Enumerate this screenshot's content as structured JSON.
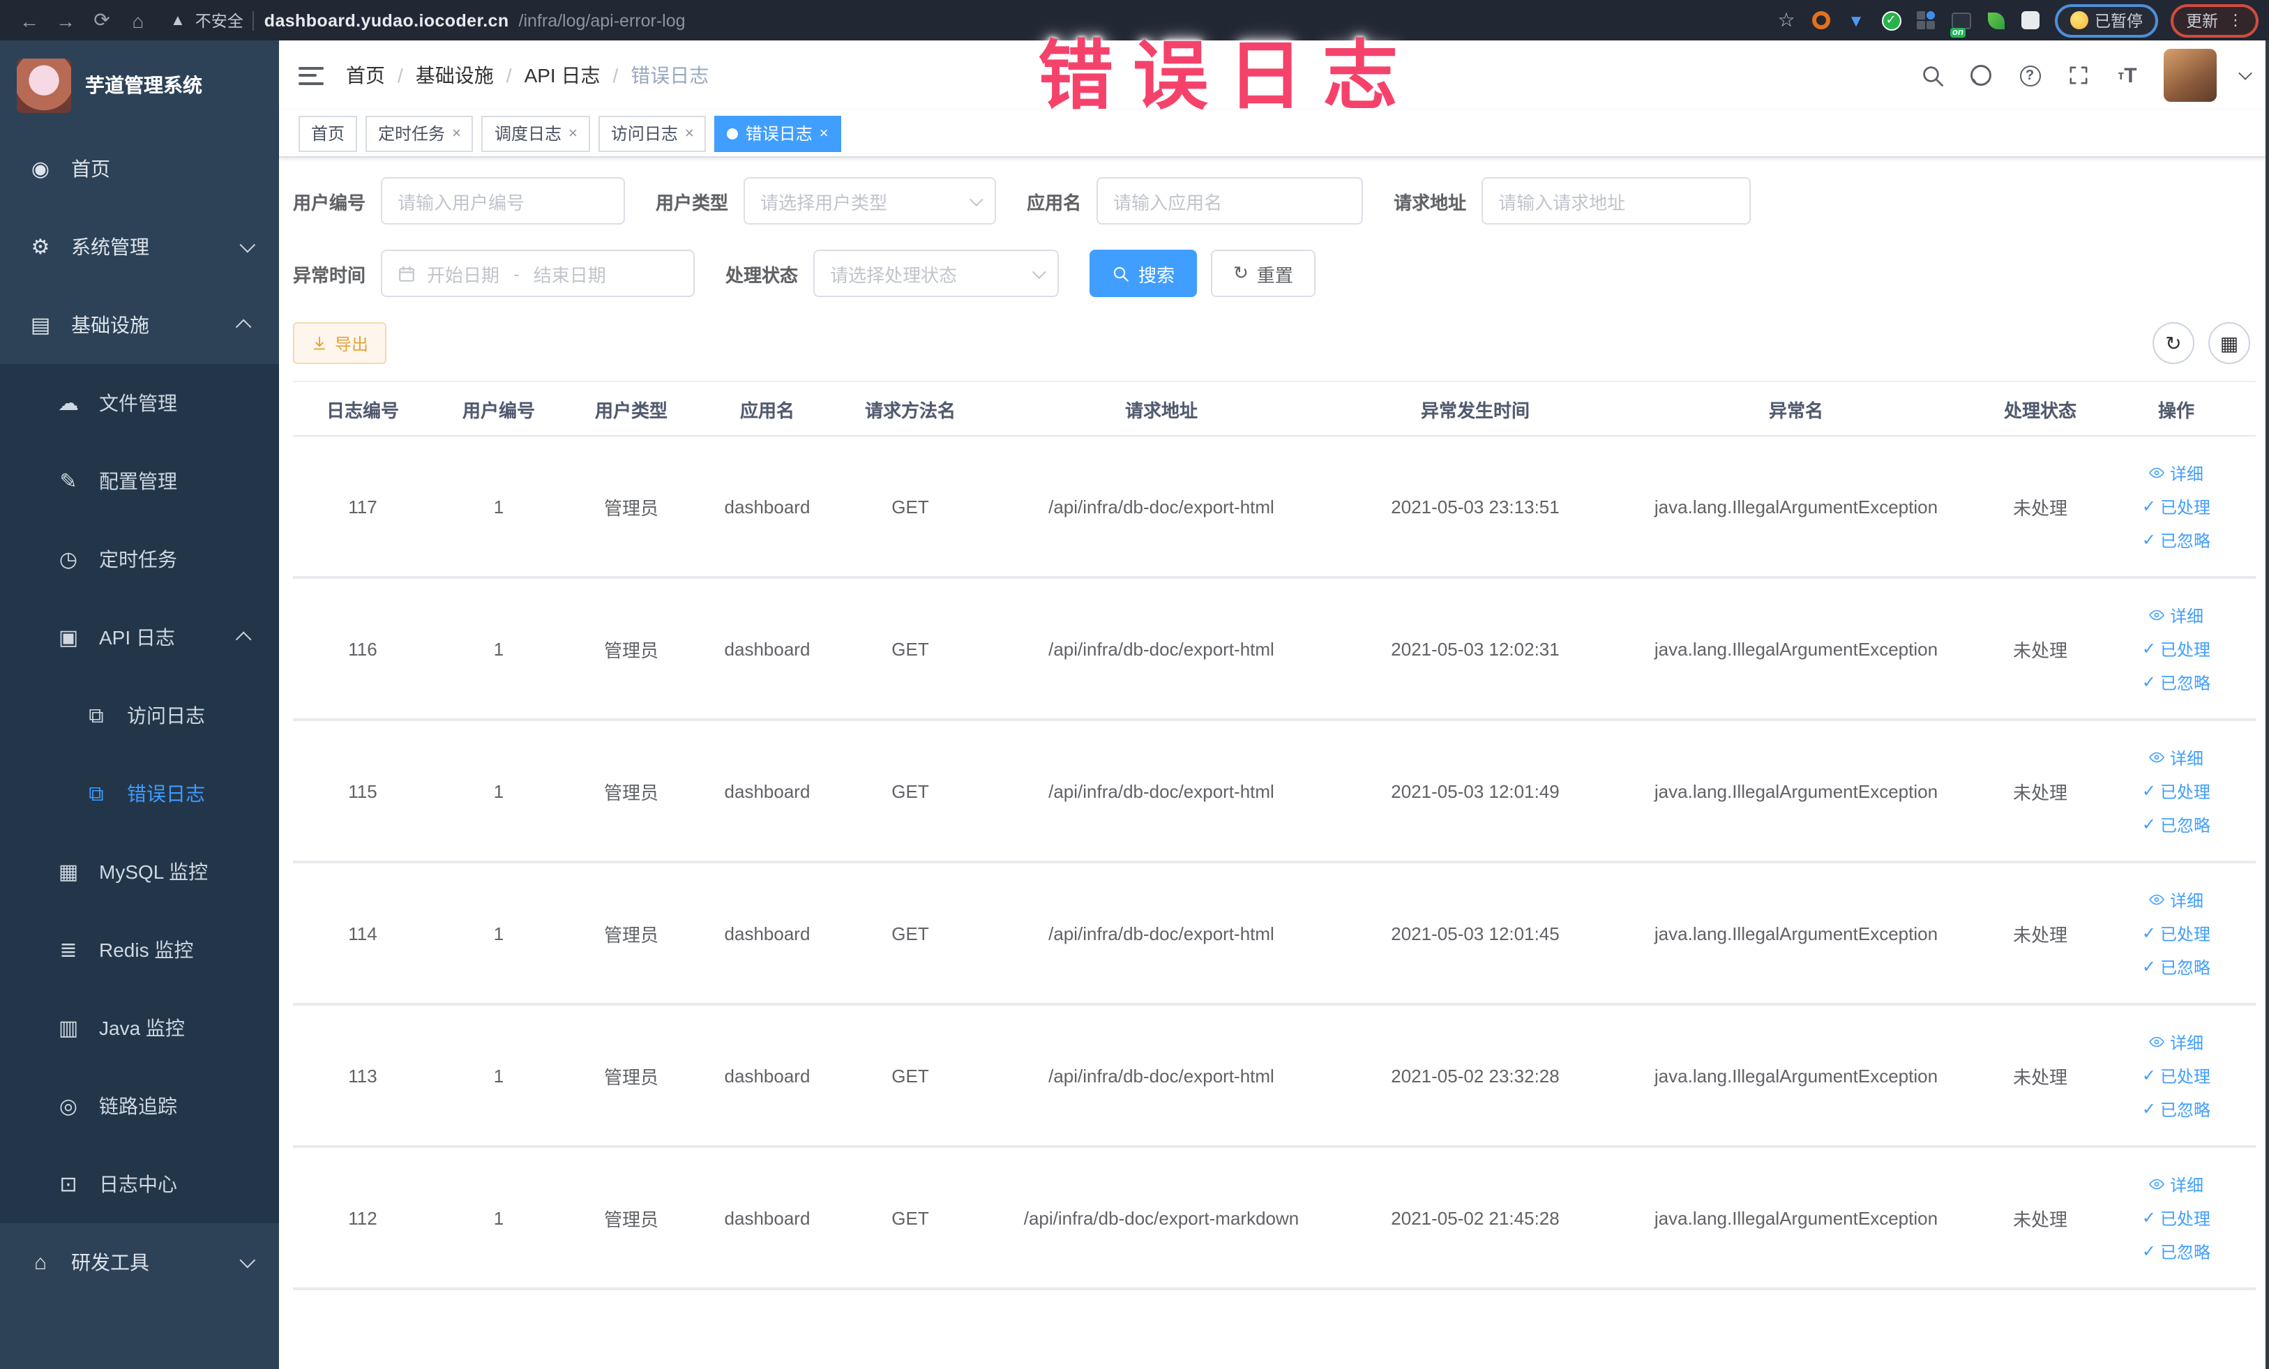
{
  "browser": {
    "nav": {
      "back": "back",
      "forward": "forward",
      "reload": "reload",
      "home": "home"
    },
    "security_label": "不安全",
    "url_host": "dashboard.yudao.iocoder.cn",
    "url_path": "/infra/log/api-error-log",
    "extensions": [
      {
        "name": "bookmark-star-icon"
      },
      {
        "name": "ext-orange-icon"
      },
      {
        "name": "ext-blue-shield-icon"
      },
      {
        "name": "ext-green-check-icon"
      },
      {
        "name": "ext-grid-icon"
      },
      {
        "name": "ext-switch-icon",
        "badge": "on"
      },
      {
        "name": "ext-leaf-icon"
      },
      {
        "name": "extensions-puzzle-icon"
      }
    ],
    "paused_pill": "已暂停",
    "update_button": "更新"
  },
  "annotation": {
    "text": "错误日志",
    "color": "#f5426b"
  },
  "sidebar": {
    "app_title": "芋道管理系统",
    "items": [
      {
        "label": "首页",
        "icon": "dashboard-icon",
        "level": 1
      },
      {
        "label": "系统管理",
        "icon": "gear-icon",
        "level": 1,
        "arrow": "down"
      },
      {
        "label": "基础设施",
        "icon": "infrastructure-icon",
        "level": 1,
        "arrow": "up",
        "expanded": true
      },
      {
        "label": "文件管理",
        "icon": "file-upload-icon",
        "level": 2
      },
      {
        "label": "配置管理",
        "icon": "config-edit-icon",
        "level": 2
      },
      {
        "label": "定时任务",
        "icon": "timer-icon",
        "level": 2
      },
      {
        "label": "API 日志",
        "icon": "api-log-icon",
        "level": 2,
        "arrow": "up",
        "expanded": true
      },
      {
        "label": "访问日志",
        "icon": "access-log-icon",
        "level": 3
      },
      {
        "label": "错误日志",
        "icon": "error-log-icon",
        "level": 3,
        "active": true
      },
      {
        "label": "MySQL 监控",
        "icon": "mysql-monitor-icon",
        "level": 2
      },
      {
        "label": "Redis 监控",
        "icon": "redis-monitor-icon",
        "level": 2
      },
      {
        "label": "Java 监控",
        "icon": "java-monitor-icon",
        "level": 2
      },
      {
        "label": "链路追踪",
        "icon": "trace-icon",
        "level": 2
      },
      {
        "label": "日志中心",
        "icon": "log-center-icon",
        "level": 2
      },
      {
        "label": "研发工具",
        "icon": "dev-tools-icon",
        "level": 1,
        "arrow": "down"
      }
    ]
  },
  "navbar": {
    "breadcrumb": [
      "首页",
      "基础设施",
      "API 日志",
      "错误日志"
    ],
    "right_icons": [
      "search-icon",
      "github-icon",
      "help-icon",
      "fullscreen-icon",
      "font-size-icon",
      "avatar",
      "caret-down-icon"
    ]
  },
  "tabs": [
    {
      "label": "首页",
      "closable": false,
      "active": false
    },
    {
      "label": "定时任务",
      "closable": true,
      "active": false
    },
    {
      "label": "调度日志",
      "closable": true,
      "active": false
    },
    {
      "label": "访问日志",
      "closable": true,
      "active": false
    },
    {
      "label": "错误日志",
      "closable": true,
      "active": true
    }
  ],
  "filters": {
    "user_id": {
      "label": "用户编号",
      "placeholder": "请输入用户编号"
    },
    "user_type": {
      "label": "用户类型",
      "placeholder": "请选择用户类型"
    },
    "app_name": {
      "label": "应用名",
      "placeholder": "请输入应用名"
    },
    "request_url": {
      "label": "请求地址",
      "placeholder": "请输入请求地址"
    },
    "exception_time": {
      "label": "异常时间",
      "start_placeholder": "开始日期",
      "separator": "-",
      "end_placeholder": "结束日期"
    },
    "process_status": {
      "label": "处理状态",
      "placeholder": "请选择处理状态"
    },
    "search_button": "搜索",
    "reset_button": "重置"
  },
  "toolbar": {
    "export_button": "导出"
  },
  "table": {
    "columns": [
      "日志编号",
      "用户编号",
      "用户类型",
      "应用名",
      "请求方法名",
      "请求地址",
      "异常发生时间",
      "异常名",
      "处理状态",
      "操作"
    ],
    "row_actions": [
      {
        "label": "详细",
        "icon": "eye-icon"
      },
      {
        "label": "已处理",
        "icon": "check-icon"
      },
      {
        "label": "已忽略",
        "icon": "check-icon"
      }
    ],
    "rows": [
      {
        "log_id": "117",
        "user_id": "1",
        "user_type": "管理员",
        "app_name": "dashboard",
        "method": "GET",
        "url": "/api/infra/db-doc/export-html",
        "time": "2021-05-03 23:13:51",
        "exception": "java.lang.IllegalArgumentException",
        "status": "未处理"
      },
      {
        "log_id": "116",
        "user_id": "1",
        "user_type": "管理员",
        "app_name": "dashboard",
        "method": "GET",
        "url": "/api/infra/db-doc/export-html",
        "time": "2021-05-03 12:02:31",
        "exception": "java.lang.IllegalArgumentException",
        "status": "未处理"
      },
      {
        "log_id": "115",
        "user_id": "1",
        "user_type": "管理员",
        "app_name": "dashboard",
        "method": "GET",
        "url": "/api/infra/db-doc/export-html",
        "time": "2021-05-03 12:01:49",
        "exception": "java.lang.IllegalArgumentException",
        "status": "未处理"
      },
      {
        "log_id": "114",
        "user_id": "1",
        "user_type": "管理员",
        "app_name": "dashboard",
        "method": "GET",
        "url": "/api/infra/db-doc/export-html",
        "time": "2021-05-03 12:01:45",
        "exception": "java.lang.IllegalArgumentException",
        "status": "未处理"
      },
      {
        "log_id": "113",
        "user_id": "1",
        "user_type": "管理员",
        "app_name": "dashboard",
        "method": "GET",
        "url": "/api/infra/db-doc/export-html",
        "time": "2021-05-02 23:32:28",
        "exception": "java.lang.IllegalArgumentException",
        "status": "未处理"
      },
      {
        "log_id": "112",
        "user_id": "1",
        "user_type": "管理员",
        "app_name": "dashboard",
        "method": "GET",
        "url": "/api/infra/db-doc/export-markdown",
        "time": "2021-05-02 21:45:28",
        "exception": "java.lang.IllegalArgumentException",
        "status": "未处理"
      }
    ]
  },
  "colors": {
    "accent_blue": "#409eff",
    "sidebar_bg": "#2d4257",
    "submenu_bg": "#233649",
    "chrome_bg": "#222734",
    "annotation_pink": "#f5426b",
    "export_orange": "#e6a23c"
  }
}
